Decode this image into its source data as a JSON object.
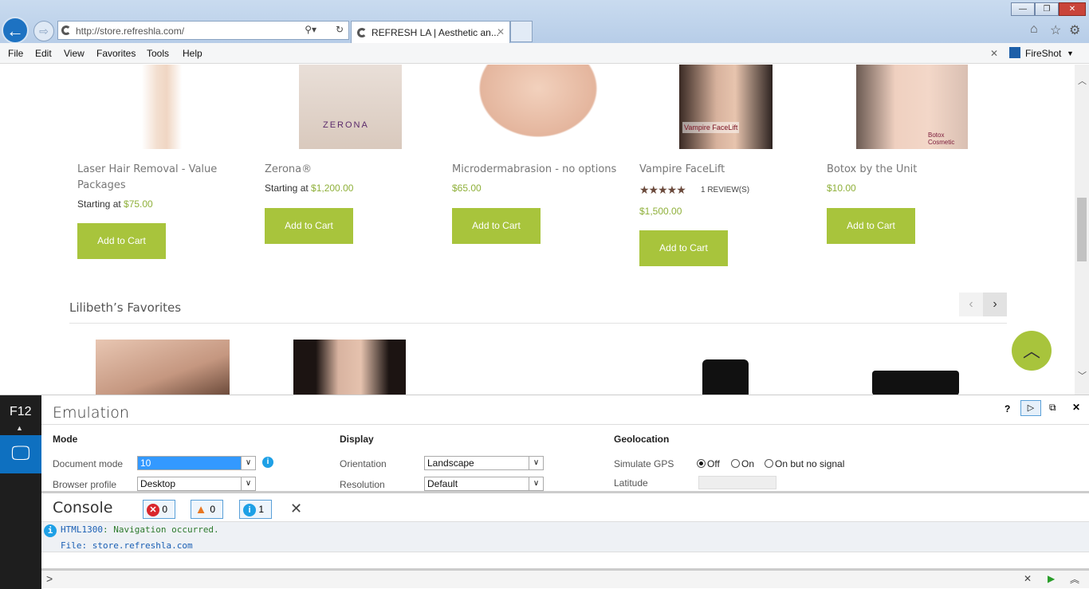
{
  "browser": {
    "url": "http://store.refreshla.com/",
    "tab_title": "REFRESH LA | Aesthetic an...",
    "menu": [
      "File",
      "Edit",
      "View",
      "Favorites",
      "Tools",
      "Help"
    ],
    "fireshot": "FireShot"
  },
  "products": [
    {
      "title": "Laser Hair Removal - Value Packages",
      "price_prefix": "Starting at ",
      "price": "$75.00",
      "button": "Add to Cart"
    },
    {
      "title": "Zerona®",
      "price_prefix": "Starting at ",
      "price": "$1,200.00",
      "button": "Add to Cart",
      "img_text": "ZERONA"
    },
    {
      "title": "Microdermabrasion - no options",
      "price_prefix": "",
      "price": "$65.00",
      "button": "Add to Cart"
    },
    {
      "title": "Vampire FaceLift",
      "reviews": "1 REVIEW(S)",
      "rating": 5,
      "price_prefix": "",
      "price": "$1,500.00",
      "button": "Add to Cart",
      "img_text": "Vampire FaceLift"
    },
    {
      "title": "Botox by the Unit",
      "price_prefix": "",
      "price": "$10.00",
      "button": "Add to Cart",
      "img_text": "Botox Cosmetic"
    }
  ],
  "section_title": "Lilibeth’s Favorites",
  "colors": {
    "accent": "#a8c43c",
    "price": "#8fb03a"
  },
  "devtools": {
    "f12": "F12",
    "panel_title": "Emulation",
    "mode": {
      "header": "Mode",
      "document_mode_label": "Document mode",
      "document_mode": "10",
      "browser_profile_label": "Browser profile",
      "browser_profile": "Desktop"
    },
    "display": {
      "header": "Display",
      "orientation_label": "Orientation",
      "orientation": "Landscape",
      "resolution_label": "Resolution",
      "resolution": "Default"
    },
    "geolocation": {
      "header": "Geolocation",
      "simulate_label": "Simulate GPS",
      "options": [
        "Off",
        "On",
        "On but no signal"
      ],
      "selected": "Off",
      "latitude_label": "Latitude"
    },
    "console": {
      "title": "Console",
      "errors": "0",
      "warnings": "0",
      "infos": "1",
      "message_code": "HTML1300",
      "message_text": ": Navigation occurred.",
      "message_file": "File: store.refreshla.com",
      "prompt": ">"
    }
  }
}
